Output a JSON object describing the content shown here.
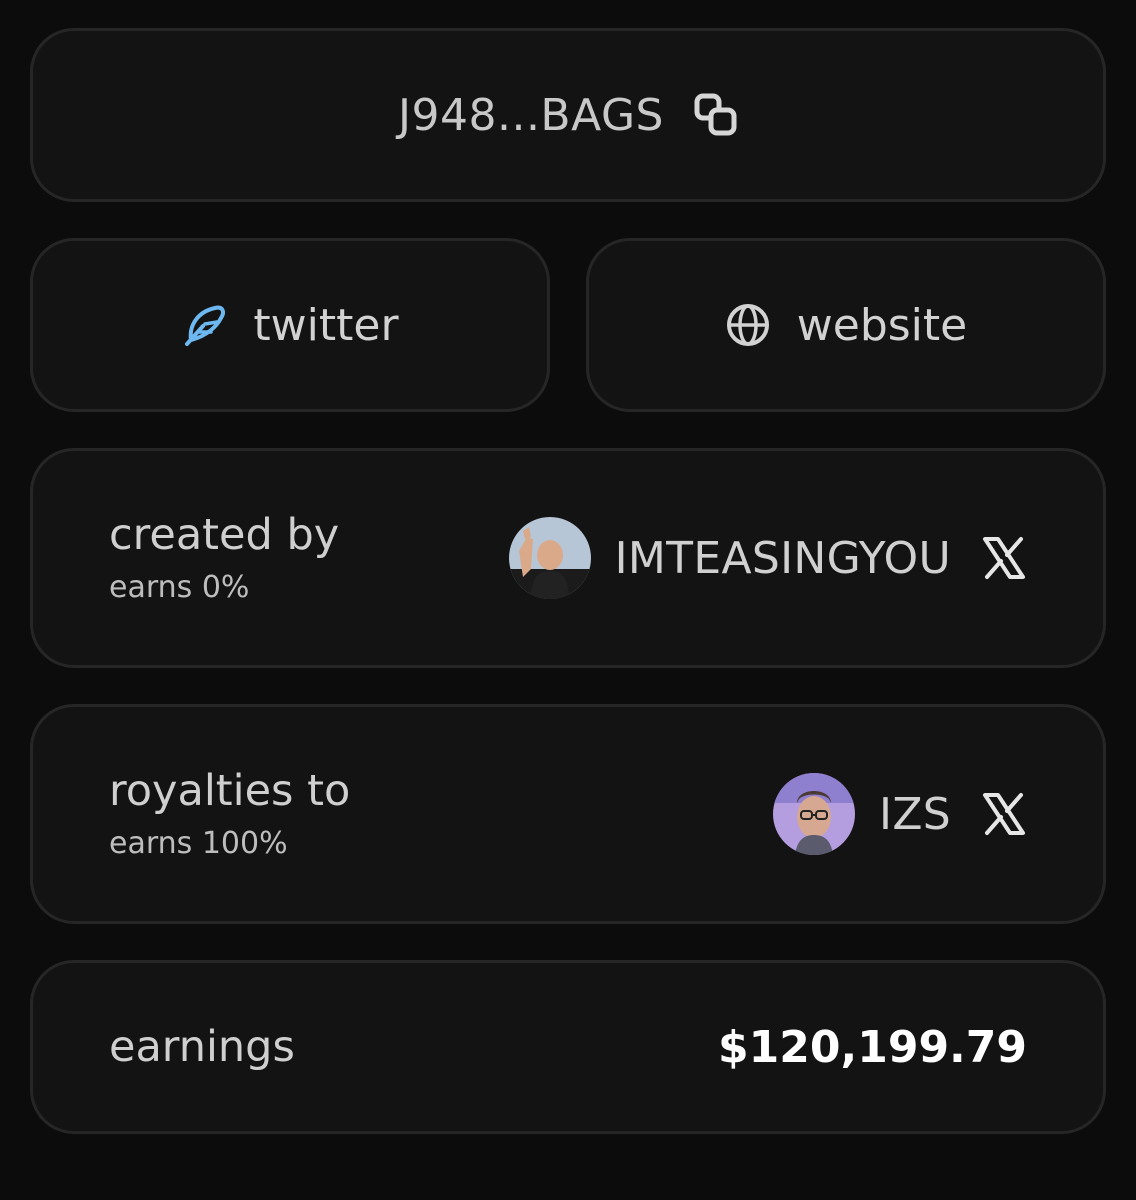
{
  "token": {
    "address_short": "J948...BAGS",
    "copy_icon": "copy-icon"
  },
  "links": {
    "twitter_label": "twitter",
    "twitter_icon": "feather-icon",
    "website_label": "website",
    "website_icon": "globe-icon"
  },
  "creator": {
    "title": "created by",
    "subtitle": "earns 0%",
    "username": "IMTEASINGYOU",
    "social_icon": "x-icon"
  },
  "royalties": {
    "title": "royalties to",
    "subtitle": "earns 100%",
    "username": "IZS",
    "social_icon": "x-icon"
  },
  "earnings": {
    "label": "earnings",
    "value": "$120,199.79"
  },
  "colors": {
    "background": "#0c0c0d",
    "card": "#131313",
    "card_border": "#262626",
    "twitter_accent": "#6db8f0",
    "value_text": "#ffffff"
  }
}
